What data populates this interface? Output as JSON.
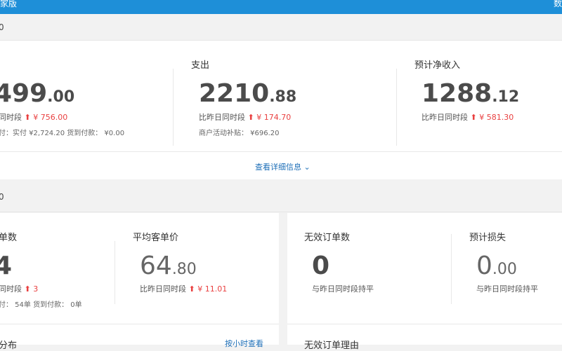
{
  "topbar": {
    "left_text": "家版",
    "right_text": "数"
  },
  "sections": [
    {
      "title": "0"
    },
    {
      "title": "0"
    }
  ],
  "income": {
    "total": {
      "label": "",
      "int": "499",
      "dec": ".00",
      "cmp_prefix": "同时段",
      "cmp_value": "¥ 756.00",
      "sub": "付：实付 ¥2,724.20   货到付款： ¥0.00"
    },
    "expense": {
      "label": "支出",
      "int": "2210",
      "dec": ".88",
      "cmp_prefix": "比昨日同时段",
      "cmp_value": "¥ 174.70",
      "sub": "商户活动补贴： ¥696.20"
    },
    "net": {
      "label": "预计净收入",
      "int": "1288",
      "dec": ".12",
      "cmp_prefix": "比昨日同时段",
      "cmp_value": "¥ 581.30"
    },
    "details_link": "查看详细信息"
  },
  "orders": {
    "count": {
      "label": "单数",
      "int": "4",
      "cmp_prefix": "同时段",
      "cmp_value": "3",
      "sub": "付： 54单    货到付款： 0单"
    },
    "avg": {
      "label": "平均客单价",
      "int": "64",
      "dec": ".80",
      "cmp_prefix": "比昨日同时段",
      "cmp_value": "¥ 11.01"
    },
    "distribution_label": "分布",
    "hourly_link": "按小时查看"
  },
  "invalid": {
    "count": {
      "label": "无效订单数",
      "int": "0",
      "cmp": "与昨日同时段持平"
    },
    "loss": {
      "label": "预计损失",
      "int": "0",
      "dec": ".00",
      "cmp": "与昨日同时段持平"
    },
    "reason_label": "无效订单理由"
  },
  "colors": {
    "topbar": "#1e8fd8",
    "up_arrow": "#e94040",
    "link": "#1e6fb8"
  }
}
